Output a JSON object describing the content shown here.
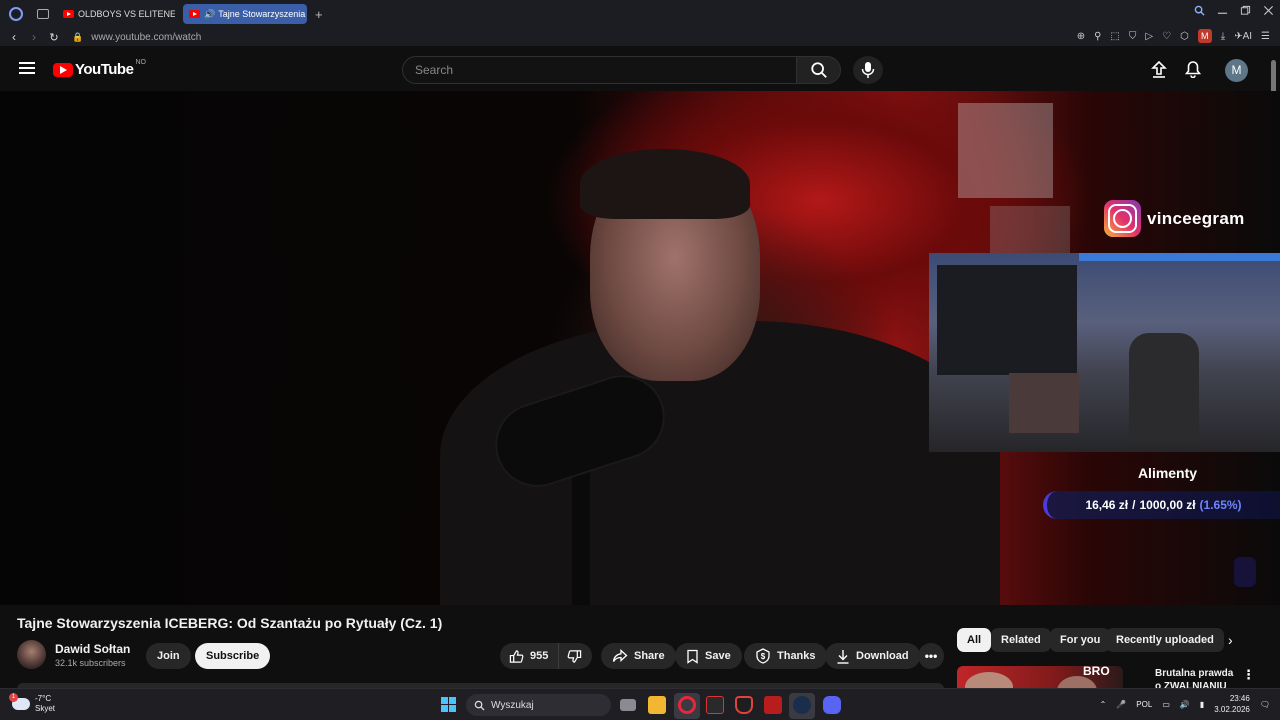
{
  "browser": {
    "tabs": [
      {
        "label": "OLDBOYS VS ELITENERGY",
        "active": false
      },
      {
        "label": "Tajne Stowarzyszenia I",
        "active": true
      }
    ],
    "new_tab": "+",
    "url": "www.youtube.com/watch",
    "profile_initial": "M",
    "ai_label": "AI"
  },
  "youtube": {
    "logo_text": "YouTube",
    "country_code": "NO",
    "search_placeholder": "Search",
    "avatar_initial": "M"
  },
  "video": {
    "overlay": {
      "instagram_handle": "vinceegram",
      "goal_title": "Alimenty",
      "goal_current": "16,46 zł",
      "goal_separator": "/",
      "goal_target": "1000,00 zł",
      "goal_percent": "(1.65%)",
      "goal_progress": 0.0165
    },
    "title": "Tajne Stowarzyszenia ICEBERG: Od Szantażu po Rytuały (Cz. 1)",
    "channel": {
      "name": "Dawid Sołtan",
      "subscribers": "32.1k subscribers"
    },
    "buttons": {
      "join": "Join",
      "subscribe": "Subscribe",
      "likes": "955",
      "share": "Share",
      "save": "Save",
      "thanks": "Thanks",
      "download": "Download"
    }
  },
  "sidebar": {
    "chips": [
      "All",
      "Related",
      "For you",
      "Recently uploaded"
    ],
    "active_chip": "All",
    "recommendations": [
      {
        "thumb_text": "BRO",
        "title": "Brutalna prawda o ZWALNIANIU"
      }
    ]
  },
  "taskbar": {
    "weather_temp": "-7°C",
    "weather_desc": "Skyet",
    "weather_badge": "1",
    "search_placeholder": "Wyszukaj",
    "language": "POL",
    "time": "23:46",
    "date": "3.02.2026"
  }
}
